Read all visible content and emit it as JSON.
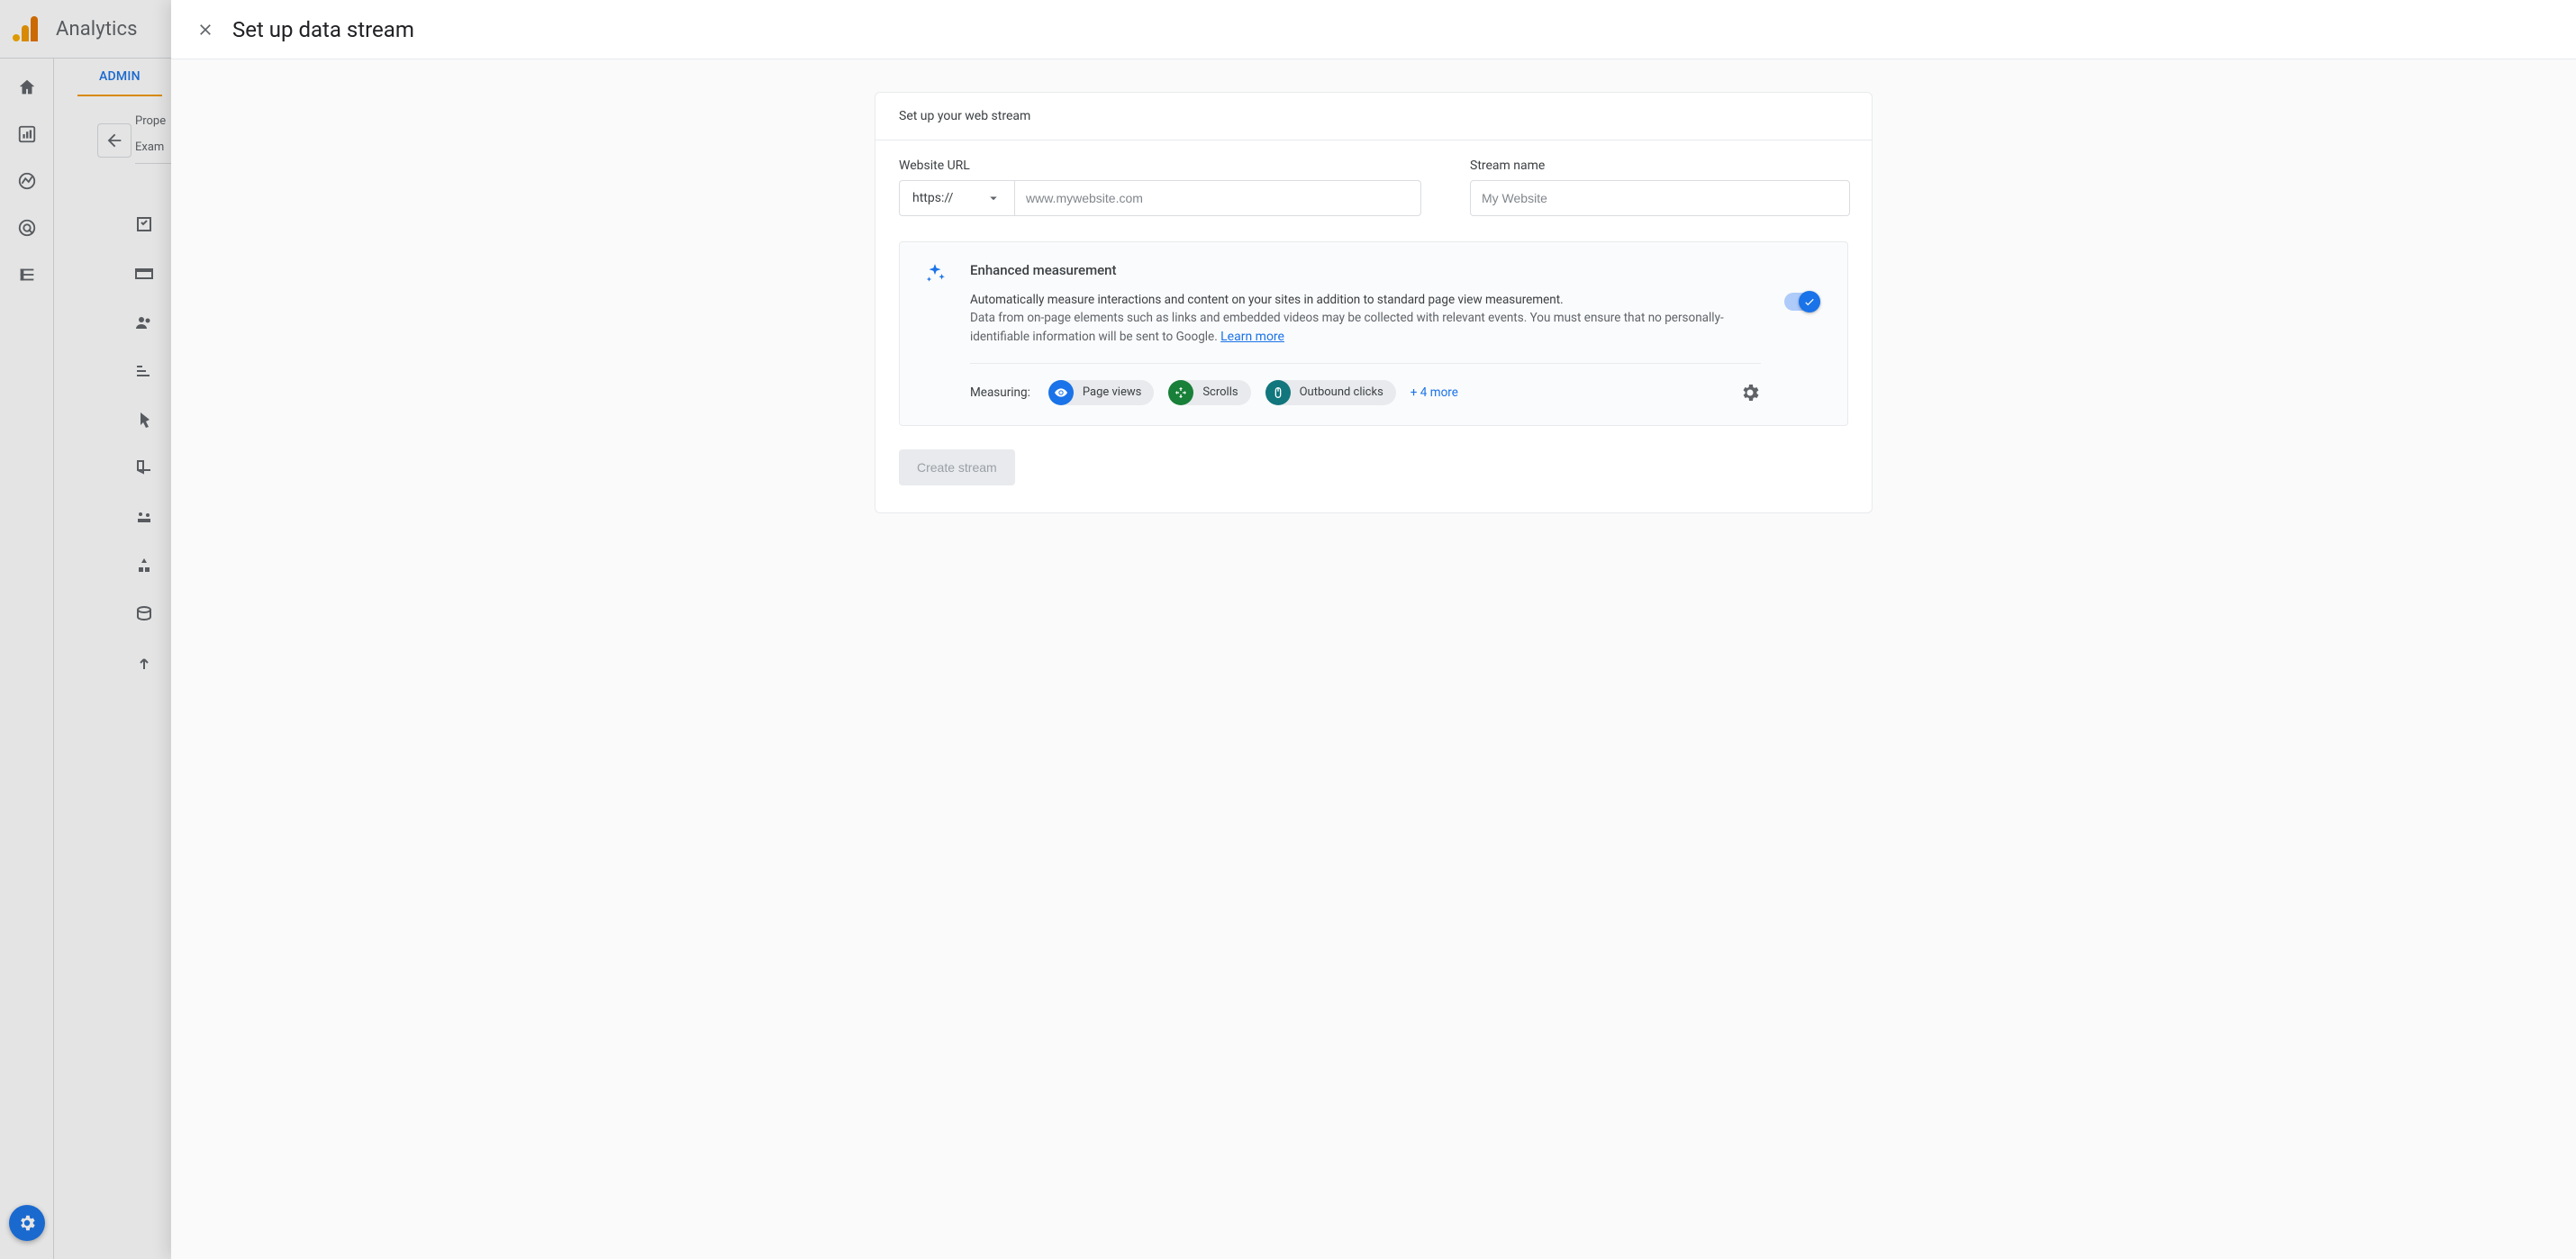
{
  "topbar": {
    "product": "Analytics"
  },
  "admin": {
    "tab_label": "ADMIN",
    "property_label": "Prope",
    "property_value": "Exam"
  },
  "panel": {
    "title": "Set up data stream",
    "card_heading": "Set up your web stream",
    "url_label": "Website URL",
    "url_protocol": "https://",
    "url_placeholder": "www.mywebsite.com",
    "name_label": "Stream name",
    "name_placeholder": "My Website",
    "enhanced": {
      "title": "Enhanced measurement",
      "desc1": "Automatically measure interactions and content on your sites in addition to standard page view measurement.",
      "desc2": "Data from on-page elements such as links and embedded videos may be collected with relevant events. You must ensure that no personally-identifiable information will be sent to Google. ",
      "learn_more": "Learn more",
      "measuring_label": "Measuring:",
      "pills": [
        {
          "icon": "eye",
          "color": "blue",
          "label": "Page views"
        },
        {
          "icon": "scroll",
          "color": "green",
          "label": "Scrolls"
        },
        {
          "icon": "mouse",
          "color": "teal",
          "label": "Outbound clicks"
        }
      ],
      "more": "+ 4 more"
    },
    "create_button": "Create stream"
  }
}
